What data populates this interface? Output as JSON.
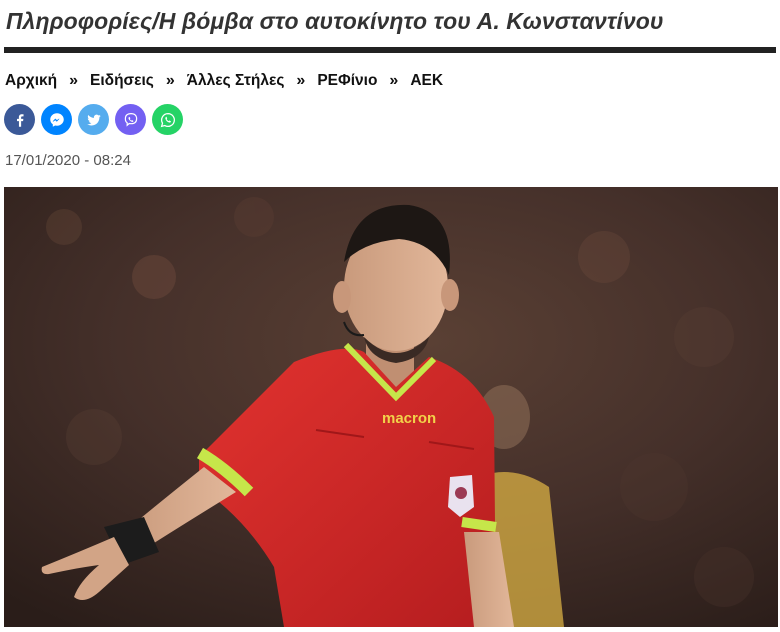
{
  "article": {
    "title": "Πληροφορίες/Η βόμβα στο αυτοκίνητο του Α. Κωνσταντίνου",
    "date": "17/01/2020 - 08:24"
  },
  "breadcrumb": {
    "separator": "»",
    "items": [
      {
        "label": "Αρχική"
      },
      {
        "label": "Ειδήσεις"
      },
      {
        "label": "Άλλες Στήλες"
      },
      {
        "label": "ΡΕΦίνιο"
      },
      {
        "label": "ΑΕΚ"
      }
    ]
  },
  "share": {
    "buttons": [
      {
        "icon": "facebook-icon",
        "color": "#3b5998"
      },
      {
        "icon": "messenger-icon",
        "color": "#0084ff"
      },
      {
        "icon": "twitter-icon",
        "color": "#55acee"
      },
      {
        "icon": "viber-icon",
        "color": "#7360f2"
      },
      {
        "icon": "whatsapp-icon",
        "color": "#25d366"
      }
    ]
  },
  "hero_image": {
    "jersey_brand": "macron"
  }
}
